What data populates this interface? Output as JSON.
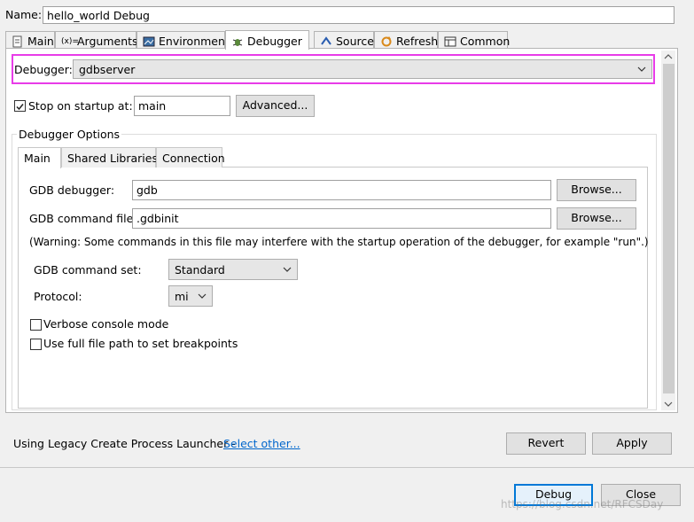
{
  "config": {
    "name_label": "Name:",
    "name_value": "hello_world Debug"
  },
  "tabs": [
    {
      "label": "Main",
      "icon": "main-tab-icon"
    },
    {
      "label": "Arguments",
      "icon": "arguments-icon"
    },
    {
      "label": "Environment",
      "icon": "environment-icon"
    },
    {
      "label": "Debugger",
      "icon": "debugger-bug-icon",
      "active": true
    },
    {
      "label": "Source",
      "icon": "source-icon"
    },
    {
      "label": "Refresh",
      "icon": "refresh-icon"
    },
    {
      "label": "Common",
      "icon": "common-icon"
    }
  ],
  "debugger": {
    "label": "Debugger:",
    "value": "gdbserver",
    "stop_on_startup_label": "Stop on startup at:",
    "stop_on_startup_checked": true,
    "stop_on_startup_value": "main",
    "advanced_button": "Advanced..."
  },
  "options": {
    "group_label": "Debugger Options",
    "tabs": [
      "Main",
      "Shared Libraries",
      "Connection"
    ],
    "gdb_debugger_label": "GDB debugger:",
    "gdb_debugger_value": "gdb",
    "browse_label": "Browse...",
    "gdb_command_file_label": "GDB command file:",
    "gdb_command_file_value": ".gdbinit",
    "warning": "(Warning: Some commands in this file may interfere with the startup operation of the debugger, for example \"run\".)",
    "command_set_label": "GDB command set:",
    "command_set_value": "Standard",
    "protocol_label": "Protocol:",
    "protocol_value": "mi",
    "verbose_label": "Verbose console mode",
    "verbose_checked": false,
    "fullpath_label": "Use full file path to set breakpoints",
    "fullpath_checked": false
  },
  "footer": {
    "launcher_text": "Using Legacy Create Process Launcher - ",
    "select_other": "Select other...",
    "revert": "Revert",
    "apply": "Apply",
    "debug": "Debug",
    "close": "Close",
    "watermark": "https://blog.csdn.net/RFCSDay"
  },
  "colors": {
    "highlight_border": "#e83ce8",
    "link": "#0066cc",
    "default_button": "#0078d7"
  }
}
